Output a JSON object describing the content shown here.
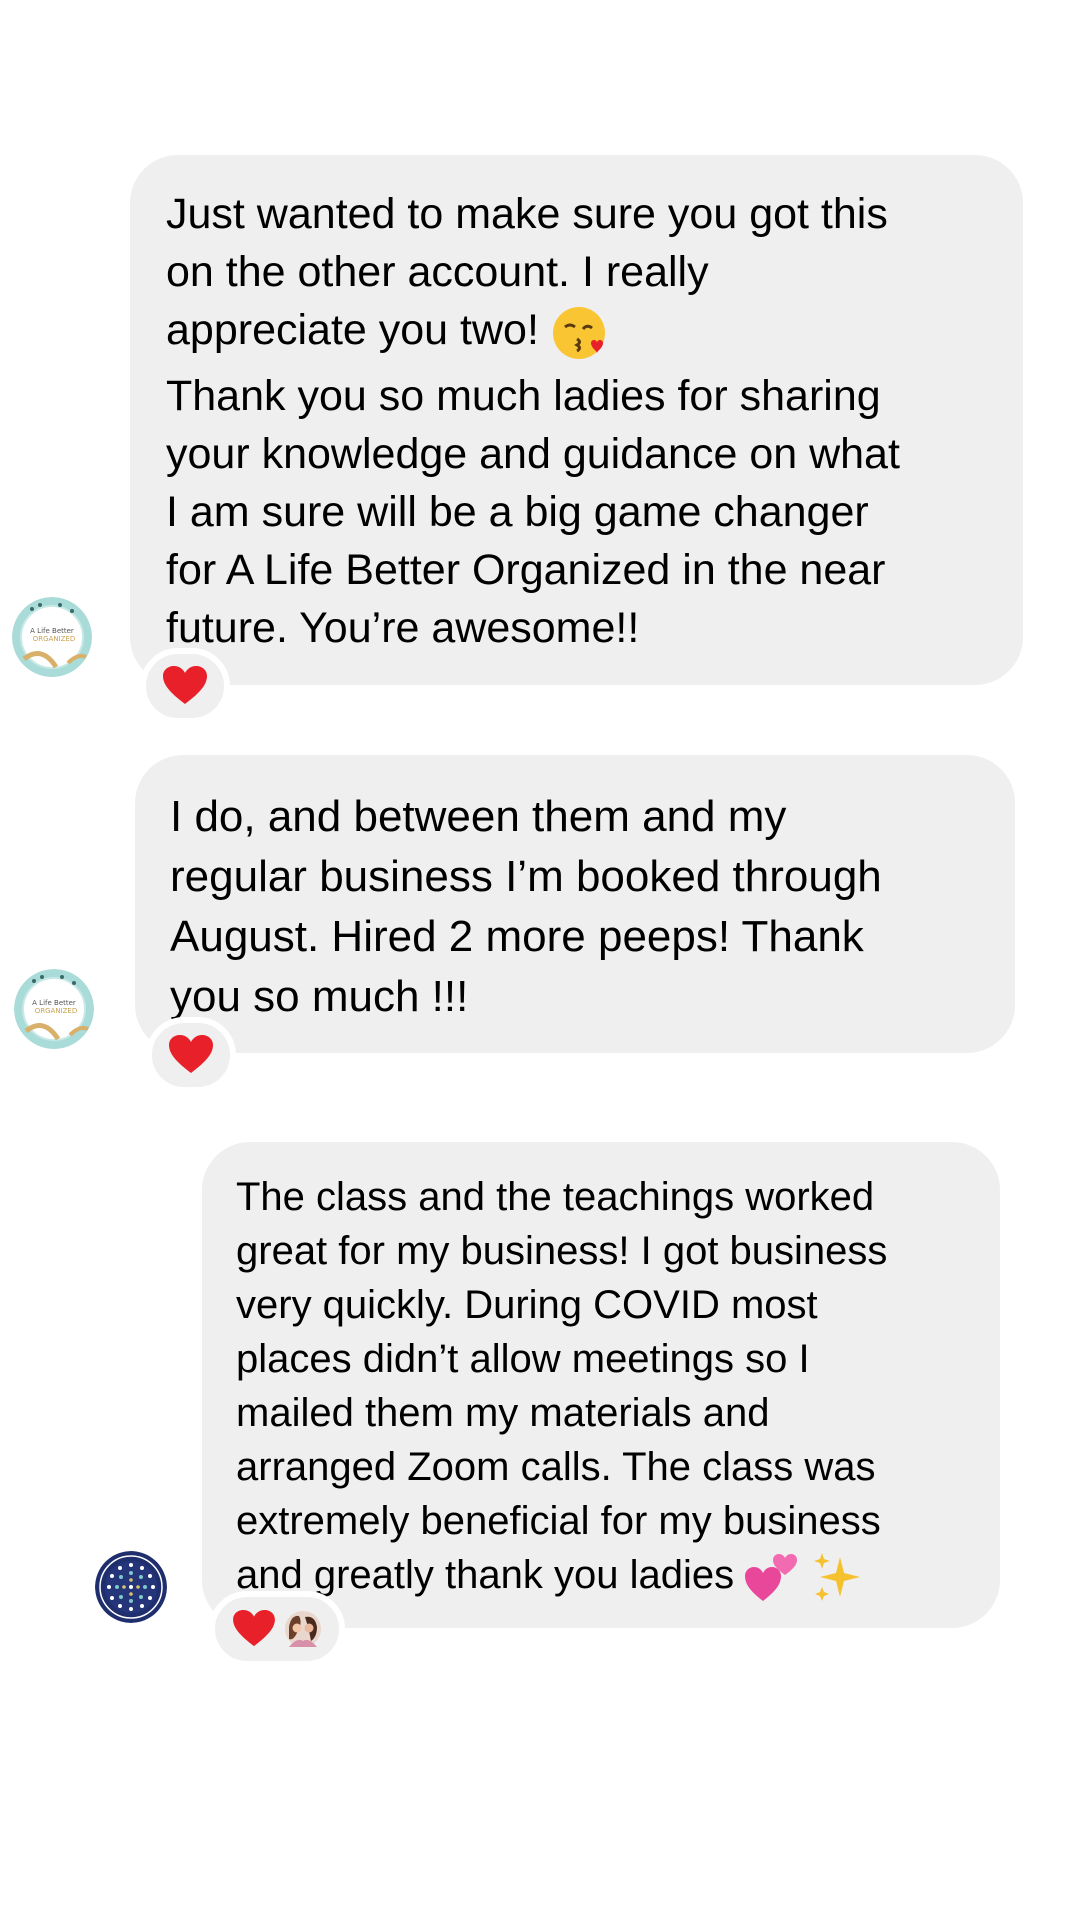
{
  "messages": [
    {
      "sender": "A Life Better Organized",
      "avatar_icon": "organized-logo-avatar",
      "text1": "Just wanted to make sure you got this\non the other account. I really\nappreciate you two! ",
      "text1_emoji": "kissing-heart-emoji",
      "text2": "Thank you so much ladies for sharing\nyour knowledge and guidance on what\nI am sure will be a big game changer\nfor A Life Better Organized in the near\nfuture. You’re awesome!!",
      "reactions": [
        "red-heart-icon"
      ]
    },
    {
      "sender": "A Life Better Organized",
      "avatar_icon": "organized-logo-avatar",
      "text": "I do, and between them and my\nregular business I’m booked through\nAugust. Hired 2 more peeps! Thank\nyou so much !!!",
      "reactions": [
        "red-heart-icon"
      ]
    },
    {
      "avatar_icon": "blue-circle-avatar",
      "text": "The class and the teachings worked\ngreat for my business! I got business\nvery quickly. During COVID most\nplaces didn’t allow meetings so I\nmailed them my materials and\narranged Zoom calls. The class was\nextremely beneficial for my business\nand greatly thank you ladies ",
      "emojis": [
        "two-hearts-emoji",
        "sparkles-emoji"
      ],
      "reactions": [
        "red-heart-icon",
        "user-avatar-reaction"
      ]
    }
  ],
  "colors": {
    "bubble": "#efefef",
    "background": "#ffffff",
    "heart": "#e8202a"
  }
}
